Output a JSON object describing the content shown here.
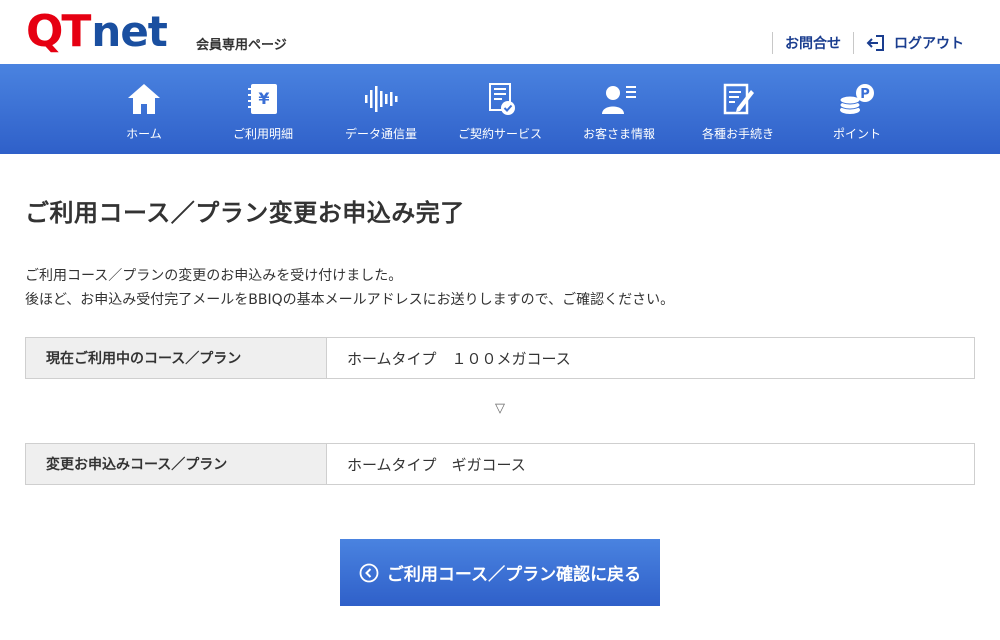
{
  "header": {
    "logo_q": "Q",
    "logo_t": "T",
    "logo_net": "net",
    "member_label": "会員専用ページ",
    "contact_label": "お問合せ",
    "logout_label": "ログアウト",
    "logout_icon": "logout-icon"
  },
  "nav": {
    "items": [
      {
        "label": "ホーム",
        "icon": "home-icon"
      },
      {
        "label": "ご利用明細",
        "icon": "billing-statement-icon"
      },
      {
        "label": "データ通信量",
        "icon": "sound-wave-icon"
      },
      {
        "label": "ご契約サービス",
        "icon": "contract-document-icon"
      },
      {
        "label": "お客さま情報",
        "icon": "customer-profile-icon"
      },
      {
        "label": "各種お手続き",
        "icon": "edit-document-icon"
      },
      {
        "label": "ポイント",
        "icon": "coins-point-icon"
      }
    ]
  },
  "main": {
    "title": "ご利用コース／プラン変更お申込み完了",
    "message_line1": "ご利用コース／プランの変更のお申込みを受け付けました。",
    "message_line2": "後ほど、お申込み受付完了メールをBBIQの基本メールアドレスにお送りしますので、ご確認ください。",
    "current_plan": {
      "label": "現在ご利用中のコース／プラン",
      "value": "ホームタイプ　１００メガコース"
    },
    "arrow": "▽",
    "new_plan": {
      "label": "変更お申込みコース／プラン",
      "value": "ホームタイプ　ギガコース"
    },
    "back_button_label": "ご利用コース／プラン確認に戻る"
  },
  "colors": {
    "brand_red": "#e60012",
    "brand_blue": "#1a4fa0",
    "nav_top": "#4a83e0",
    "nav_bottom": "#2f60c9"
  }
}
